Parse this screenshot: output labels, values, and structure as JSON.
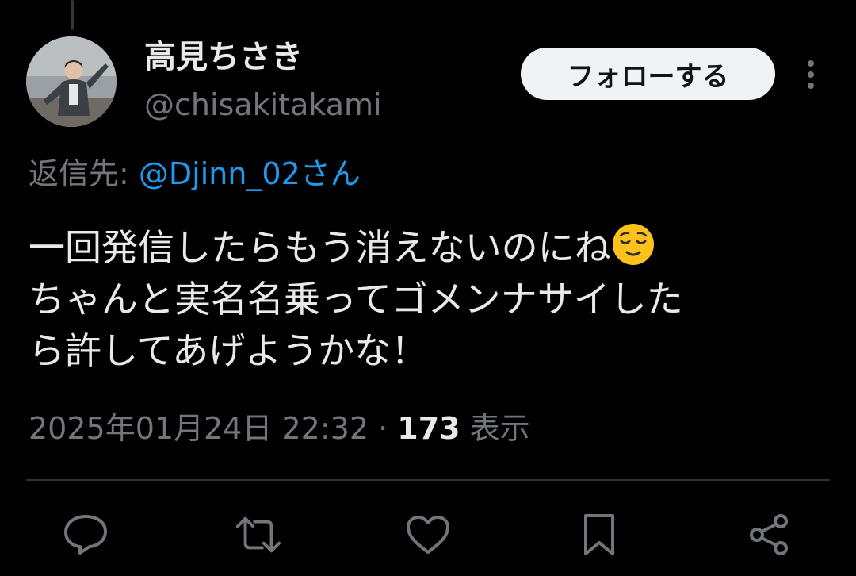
{
  "tweet": {
    "author": {
      "display_name": "高見ちさき",
      "handle": "@chisakitakami"
    },
    "follow_label": "フォローする",
    "reply_to": {
      "label": "返信先: ",
      "mention": "@Djinn_02さん"
    },
    "text_lines": [
      "一回発信したらもう消えないのにね",
      "ちゃんと実名名乗ってゴメンナサイした",
      "ら許してあげようかな！"
    ],
    "emoji": "relieved-face",
    "timestamp": "2025年01月24日 22:32",
    "separator": " · ",
    "views_count": "173",
    "views_label": " 表示"
  },
  "icons": {
    "more": "more-vertical-icon",
    "reply": "reply-icon",
    "retweet": "retweet-icon",
    "like": "heart-icon",
    "bookmark": "bookmark-icon",
    "share": "share-icon"
  },
  "colors": {
    "background": "#000000",
    "text_primary": "#e7e9ea",
    "text_secondary": "#71767b",
    "link": "#1d9bf0",
    "button_bg": "#eff3f4"
  }
}
